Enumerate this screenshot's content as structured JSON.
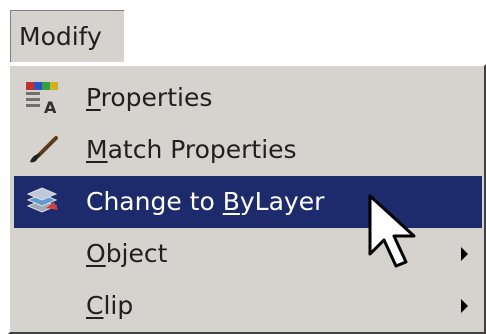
{
  "menubar": {
    "title": "Modify"
  },
  "menu": {
    "items": [
      {
        "pre": "",
        "mnemonic": "P",
        "post": "roperties",
        "icon": "properties-icon",
        "has_submenu": false,
        "highlighted": false
      },
      {
        "pre": "",
        "mnemonic": "M",
        "post": "atch Properties",
        "icon": "paintbrush-icon",
        "has_submenu": false,
        "highlighted": false
      },
      {
        "pre": "Change to ",
        "mnemonic": "B",
        "post": "yLayer",
        "icon": "change-to-bylayer-icon",
        "has_submenu": false,
        "highlighted": true
      },
      {
        "pre": "",
        "mnemonic": "O",
        "post": "bject",
        "icon": "",
        "has_submenu": true,
        "highlighted": false
      },
      {
        "pre": "",
        "mnemonic": "C",
        "post": "lip",
        "icon": "",
        "has_submenu": true,
        "highlighted": false
      }
    ]
  },
  "colors": {
    "menu_background": "#d6d3ce",
    "highlight": "#1d2a6b",
    "highlight_text": "#ffffff",
    "text": "#202020"
  },
  "icons": {
    "cursor": "mouse-pointer-icon",
    "submenu": "submenu-arrow-icon"
  }
}
